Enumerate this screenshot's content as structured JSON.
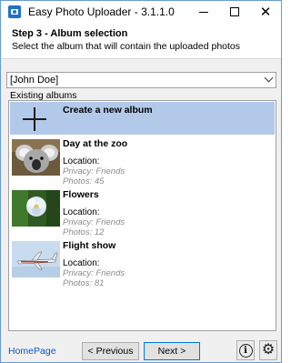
{
  "window": {
    "title": "Easy Photo Uploader - 3.1.1.0"
  },
  "header": {
    "step_title": "Step 3 - Album selection",
    "step_description": "Select the album that will contain the uploaded photos"
  },
  "account_select": {
    "value": "[John Doe]"
  },
  "albums_section_label": "Existing albums",
  "albums": [
    {
      "name": "Create a new album",
      "icon": "plus-icon",
      "selected": true
    },
    {
      "name": "Day at the zoo",
      "location": "Location:",
      "privacy": "Privacy: Friends",
      "photos": "Photos: 45",
      "thumbnail": "koala-thumbnail"
    },
    {
      "name": "Flowers",
      "location": "Location:",
      "privacy": "Privacy: Friends",
      "photos": "Photos: 12",
      "thumbnail": "flower-thumbnail"
    },
    {
      "name": "Flight show",
      "location": "Location:",
      "privacy": "Privacy: Friends",
      "photos": "Photos: 81",
      "thumbnail": "airplane-thumbnail"
    }
  ],
  "footer": {
    "homepage_link": "HomePage",
    "previous_label": "< Previous",
    "next_label": "Next >",
    "info_icon": "info-icon",
    "settings_icon": "gear-icon"
  },
  "colors": {
    "selection": "#b3c9ea",
    "link": "#0a56c8",
    "meta_text": "#8a8a8a",
    "window_border": "#6a9bd1"
  }
}
